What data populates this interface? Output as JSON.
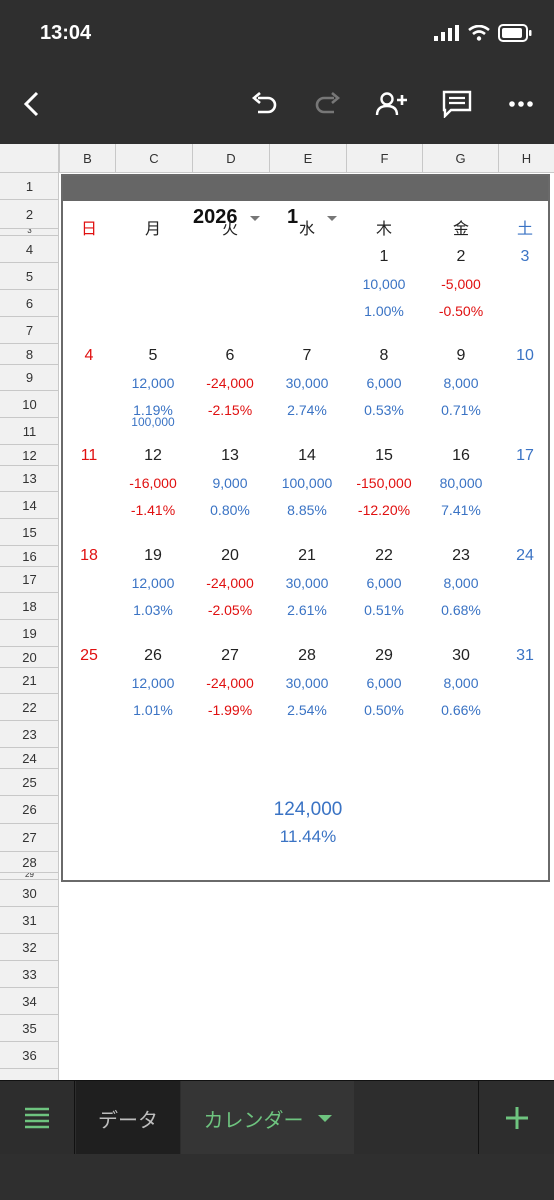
{
  "status": {
    "time": "13:04"
  },
  "toolbar": {
    "icons": [
      "back-icon",
      "undo-icon",
      "redo-icon",
      "add-person-icon",
      "comment-icon",
      "more-icon"
    ]
  },
  "grid": {
    "columns": [
      "B",
      "C",
      "D",
      "E",
      "F",
      "G",
      "H"
    ],
    "rows": [
      "1",
      "2",
      "3",
      "4",
      "5",
      "6",
      "7",
      "8",
      "9",
      "10",
      "11",
      "12",
      "13",
      "14",
      "15",
      "16",
      "17",
      "18",
      "19",
      "20",
      "21",
      "22",
      "23",
      "24",
      "25",
      "26",
      "27",
      "28",
      "29",
      "30",
      "31",
      "32",
      "33",
      "34",
      "35",
      "36"
    ]
  },
  "calendar": {
    "year": "2026",
    "month": "1",
    "weekdays": [
      "日",
      "月",
      "火",
      "水",
      "木",
      "金",
      "土"
    ],
    "weeks": [
      {
        "days": [
          "",
          "",
          "",
          "",
          "1",
          "2",
          "3"
        ],
        "amounts": [
          "",
          "",
          "",
          "",
          "10,000",
          "-5,000",
          ""
        ],
        "rates": [
          "",
          "",
          "",
          "",
          "1.00%",
          "-0.50%",
          ""
        ]
      },
      {
        "days": [
          "4",
          "5",
          "6",
          "7",
          "8",
          "9",
          "10"
        ],
        "amounts": [
          "",
          "12,000",
          "-24,000",
          "30,000",
          "6,000",
          "8,000",
          ""
        ],
        "rates": [
          "",
          "1.19%",
          "-2.15%",
          "2.74%",
          "0.53%",
          "0.71%",
          ""
        ],
        "note": "100,000"
      },
      {
        "days": [
          "11",
          "12",
          "13",
          "14",
          "15",
          "16",
          "17"
        ],
        "amounts": [
          "",
          "-16,000",
          "9,000",
          "100,000",
          "-150,000",
          "80,000",
          ""
        ],
        "rates": [
          "",
          "-1.41%",
          "0.80%",
          "8.85%",
          "-12.20%",
          "7.41%",
          ""
        ]
      },
      {
        "days": [
          "18",
          "19",
          "20",
          "21",
          "22",
          "23",
          "24"
        ],
        "amounts": [
          "",
          "12,000",
          "-24,000",
          "30,000",
          "6,000",
          "8,000",
          ""
        ],
        "rates": [
          "",
          "1.03%",
          "-2.05%",
          "2.61%",
          "0.51%",
          "0.68%",
          ""
        ]
      },
      {
        "days": [
          "25",
          "26",
          "27",
          "28",
          "29",
          "30",
          "31"
        ],
        "amounts": [
          "",
          "12,000",
          "-24,000",
          "30,000",
          "6,000",
          "8,000",
          ""
        ],
        "rates": [
          "",
          "1.01%",
          "-1.99%",
          "2.54%",
          "0.50%",
          "0.66%",
          ""
        ]
      }
    ],
    "total_amount": "124,000",
    "total_rate": "11.44%"
  },
  "sheets": {
    "tabs": [
      "データ",
      "カレンダー"
    ],
    "active": 1
  },
  "colors": {
    "blue": "#3a73c4",
    "red": "#e01010",
    "active_tab": "#6ec47f"
  }
}
